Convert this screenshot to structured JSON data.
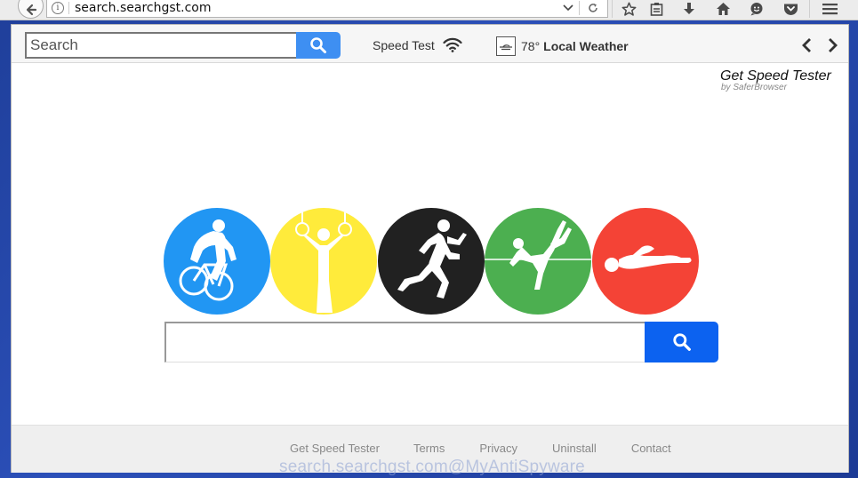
{
  "browser": {
    "url": "search.searchgst.com"
  },
  "toolbar": {
    "search_placeholder": "Search",
    "speed_test_label": "Speed Test",
    "weather_temp": "78°",
    "weather_label": "Local Weather"
  },
  "brand": {
    "title": "Get Speed Tester",
    "subtitle": "by SaferBrowser"
  },
  "sports": [
    {
      "name": "cycling",
      "color": "#2196f3"
    },
    {
      "name": "gymnastics-rings",
      "color": "#ffeb3b"
    },
    {
      "name": "running",
      "color": "#212121"
    },
    {
      "name": "high-jump",
      "color": "#4caf50"
    },
    {
      "name": "swimming",
      "color": "#f44336"
    }
  ],
  "colors": {
    "search_button": "#3e8ff2",
    "main_search_button": "#0c62f0"
  },
  "footer": {
    "links": [
      "Get Speed Tester",
      "Terms",
      "Privacy",
      "Uninstall",
      "Contact"
    ]
  },
  "watermark": "search.searchgst.com@MyAntiSpyware"
}
